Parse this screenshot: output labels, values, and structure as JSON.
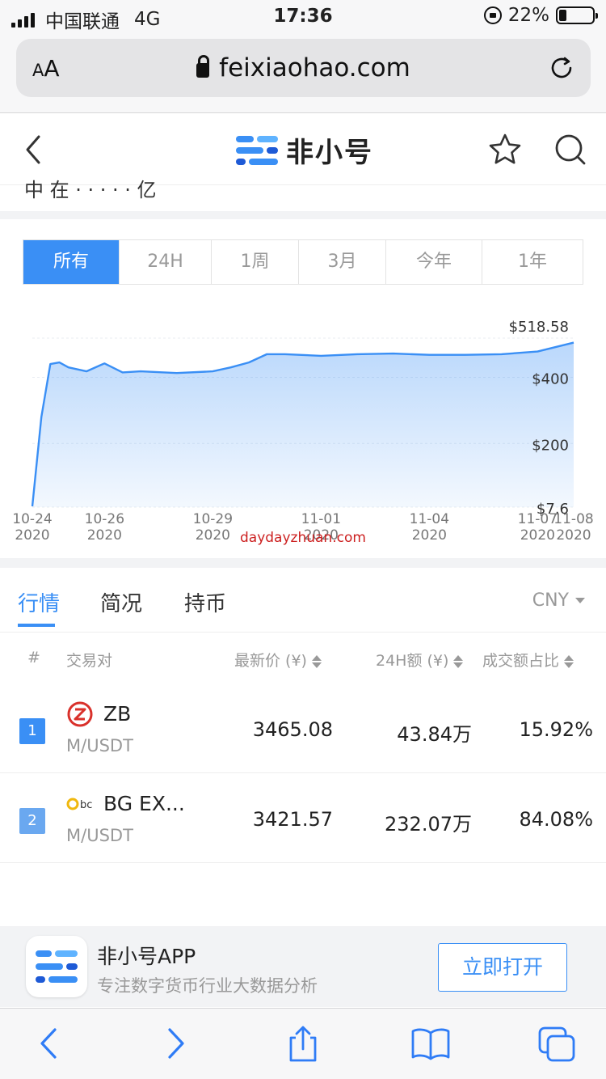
{
  "status": {
    "carrier": "中国联通",
    "network": "4G",
    "time": "17:36",
    "battery": "22%",
    "battery_level": 0.22
  },
  "browser": {
    "aa_small": "A",
    "aa_large": "A",
    "url": "feixiaohao.com"
  },
  "header": {
    "logo_text": "非小号",
    "partial_text": "中 在 · · · · · 亿"
  },
  "time_tabs": [
    {
      "label": "所有",
      "active": true
    },
    {
      "label": "24H",
      "active": false
    },
    {
      "label": "1周",
      "active": false
    },
    {
      "label": "3月",
      "active": false
    },
    {
      "label": "今年",
      "active": false
    },
    {
      "label": "1年",
      "active": false
    }
  ],
  "chart_data": {
    "type": "area",
    "y_tick_labels": [
      "$518.58",
      "$400",
      "$200",
      "$7.6"
    ],
    "ylim": [
      7.6,
      518.58
    ],
    "x_ticks": [
      {
        "top": "10-24",
        "bottom": "2020"
      },
      {
        "top": "10-26",
        "bottom": "2020"
      },
      {
        "top": "10-29",
        "bottom": "2020"
      },
      {
        "top": "11-01",
        "bottom": "2020"
      },
      {
        "top": "11-04",
        "bottom": "2020"
      },
      {
        "top": "11-07",
        "bottom": "2020"
      },
      {
        "top": "11-08",
        "bottom": "2020"
      }
    ],
    "series": [
      {
        "x": [
          "2020-10-24 00:00",
          "2020-10-24 06:00",
          "2020-10-24 12:00",
          "2020-10-24 18:00",
          "2020-10-25 00:00",
          "2020-10-25 12:00",
          "2020-10-26 00:00",
          "2020-10-26 12:00",
          "2020-10-27 00:00",
          "2020-10-28 00:00",
          "2020-10-29 00:00",
          "2020-10-29 12:00",
          "2020-10-30 00:00",
          "2020-10-30 12:00",
          "2020-10-31 00:00",
          "2020-11-01 00:00",
          "2020-11-02 00:00",
          "2020-11-03 00:00",
          "2020-11-04 00:00",
          "2020-11-05 00:00",
          "2020-11-06 00:00",
          "2020-11-07 00:00",
          "2020-11-08 00:00"
        ],
        "y": [
          10,
          280,
          440,
          445,
          430,
          418,
          442,
          415,
          418,
          413,
          418,
          430,
          445,
          470,
          470,
          465,
          470,
          472,
          468,
          468,
          470,
          478,
          505
        ]
      }
    ],
    "grid": true,
    "legend": "none"
  },
  "watermark": "daydayzhuan.com",
  "market_tabs": [
    {
      "label": "行情",
      "active": true
    },
    {
      "label": "简况",
      "active": false
    },
    {
      "label": "持币",
      "active": false
    }
  ],
  "currency": "CNY",
  "table": {
    "headers": {
      "rank": "#",
      "pair": "交易对",
      "price": "最新价 (¥)",
      "volume": "24H额 (¥)",
      "share": "成交额占比"
    },
    "rows": [
      {
        "rank": "1",
        "exchange": "ZB",
        "pair": "M/USDT",
        "price": "3465.08",
        "volume": "43.84万",
        "share": "15.92%",
        "logo": "zb-logo-icon"
      },
      {
        "rank": "2",
        "exchange": "BG EX...",
        "pair": "M/USDT",
        "price": "3421.57",
        "volume": "232.07万",
        "share": "84.08%",
        "logo": "bgex-logo-icon"
      }
    ]
  },
  "banner": {
    "app_name": "非小号APP",
    "app_desc": "专注数字货币行业大数据分析",
    "open_label": "立即打开"
  },
  "colors": {
    "accent": "#3a8ff5",
    "watermark": "#cc1f1f"
  }
}
